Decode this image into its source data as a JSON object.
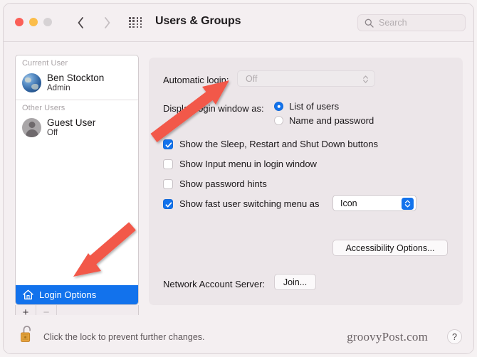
{
  "window": {
    "title": "Users & Groups",
    "traffic_lights": [
      "close",
      "minimize",
      "zoom"
    ]
  },
  "toolbar": {
    "back_icon": "chevron-left-icon",
    "forward_icon": "chevron-right-icon",
    "grid_icon": "show-all-grid-icon",
    "search": {
      "placeholder": "Search",
      "value": "",
      "icon": "search-icon"
    }
  },
  "sidebar": {
    "groups": [
      {
        "header": "Current User",
        "users": [
          {
            "name": "Ben Stockton",
            "status": "Admin",
            "avatar": "globe-avatar"
          }
        ]
      },
      {
        "header": "Other Users",
        "users": [
          {
            "name": "Guest User",
            "status": "Off",
            "avatar": "person-avatar"
          }
        ]
      }
    ],
    "login_options": {
      "label": "Login Options",
      "icon": "home-icon",
      "selected": true
    },
    "toolbar": {
      "add_label": "+",
      "remove_label": "−"
    }
  },
  "main": {
    "automatic_login": {
      "label": "Automatic login:",
      "value": "Off",
      "enabled": false,
      "options": [
        "Off"
      ]
    },
    "display_login_window": {
      "label": "Display login window as:",
      "options": [
        {
          "label": "List of users",
          "selected": true
        },
        {
          "label": "Name and password",
          "selected": false
        }
      ]
    },
    "checkboxes": [
      {
        "label": "Show the Sleep, Restart and Shut Down buttons",
        "checked": true
      },
      {
        "label": "Show Input menu in login window",
        "checked": false
      },
      {
        "label": "Show password hints",
        "checked": false
      },
      {
        "label": "Show fast user switching menu as",
        "checked": true
      }
    ],
    "fast_user_switching": {
      "value": "Icon",
      "options": [
        "Icon"
      ]
    },
    "accessibility_button": "Accessibility Options...",
    "network_account_server": {
      "label": "Network Account Server:",
      "button": "Join..."
    }
  },
  "bottom_bar": {
    "lock_icon": "unlocked-padlock-icon",
    "lock_text": "Click the lock to prevent further changes.",
    "watermark": "groovyPost.com",
    "help_label": "?"
  },
  "annotations": {
    "arrow_color": "#f2584a",
    "arrows": [
      {
        "name": "arrow-to-automatic-login",
        "points_to": "Automatic login dropdown"
      },
      {
        "name": "arrow-to-login-options",
        "points_to": "Login Options sidebar item"
      }
    ]
  },
  "colors": {
    "accent": "#1272ec",
    "window_bg": "#f4eff1",
    "panel_bg": "#ece6e9",
    "arrow": "#f2584a"
  }
}
